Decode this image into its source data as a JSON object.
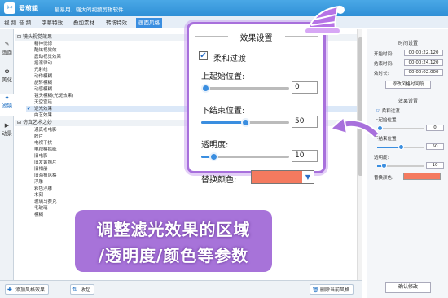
{
  "app": {
    "name": "爱剪辑",
    "tagline": "最易用、强大的视频剪辑软件"
  },
  "tabs": [
    "视 频",
    "音 频",
    "字幕特效",
    "叠加素材",
    "转场特效",
    "画面风格"
  ],
  "rail": [
    {
      "icon": "✎",
      "label": "画面"
    },
    {
      "icon": "✿",
      "label": "美化"
    },
    {
      "icon": "✦",
      "label": "滤镜"
    },
    {
      "icon": "▶",
      "label": "动景"
    }
  ],
  "list": {
    "cat1": "镜头视觉效果",
    "items1": [
      "精神恍惚",
      "酷炫视觉效",
      "震动视觉效果",
      "摇滚律动",
      "光射线",
      "动作模糊",
      "旋转模糊",
      "动感模糊",
      "镜头模糊(光斑效果)",
      "天空宫廷",
      "逆光效果",
      "曲艺效果"
    ],
    "cat2": "仿真艺术之妙",
    "items2": [
      "通真老电影",
      "胶片",
      "电视干扰",
      "电视模拟纸",
      "旧电影",
      "旧发黄照片",
      "旧相册",
      "旧海报风格",
      "浮雕",
      "彩色浮雕",
      "木刻",
      "玻璃马赛克",
      "毛玻璃",
      "模糊"
    ]
  },
  "bottom": {
    "add": "添加风格效果",
    "collapse": "收起",
    "delete": "删除当前风格"
  },
  "right": {
    "time_title": "时间设置",
    "start_label": "开始时间:",
    "start": "00:00:22.120",
    "end_label": "结束时间:",
    "end": "00:00:24.120",
    "dur_label": "效时长:",
    "dur": "00:00:02.000",
    "change_btn": "修改风格时间段",
    "effect_title": "效果设置",
    "soft": "柔和过渡",
    "up_label": "上起始位置:",
    "up_val": "0",
    "down_label": "下结束位置:",
    "down_val": "50",
    "alpha_label": "透明度:",
    "alpha_val": "10",
    "color_label": "替换颜色:",
    "confirm": "确认修改"
  },
  "popup": {
    "title": "效果设置",
    "soft": "柔和过渡",
    "up_label": "上起始位置:",
    "up_val": "0",
    "down_label": "下结束位置:",
    "down_val": "50",
    "alpha_label": "透明度:",
    "alpha_val": "10",
    "color_label": "替换颜色:"
  },
  "sliders": {
    "up": 0.0,
    "down": 0.5,
    "alpha": 0.1
  },
  "colors": {
    "accent": "#3a8ee0",
    "replace": "#f47a5f",
    "callout": "#985ad2"
  },
  "banner": {
    "line1": "调整滤光效果的区域",
    "line2": "/透明度/颜色等参数"
  }
}
